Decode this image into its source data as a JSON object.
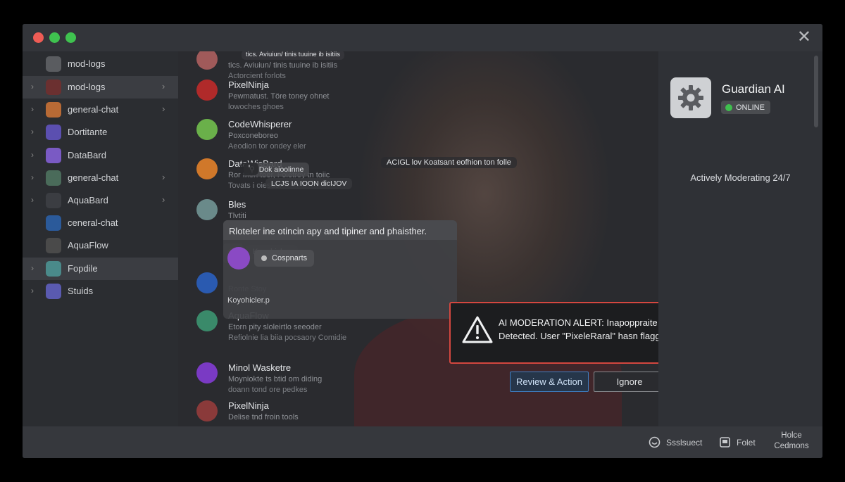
{
  "window": {
    "close_glyph": "✕"
  },
  "sidebar": {
    "items": [
      {
        "label": "mod-logs",
        "icon": "shield-avatar-icon",
        "color": "#5a5c60",
        "chev_left": "",
        "chev_right": "",
        "active": false
      },
      {
        "label": "mod-logs",
        "icon": "dark-avatar-icon",
        "color": "#6b3030",
        "chev_left": "›",
        "chev_right": "›",
        "active": true
      },
      {
        "label": "general-chat",
        "icon": "orange-avatar-icon",
        "color": "#b86a35",
        "chev_left": "›",
        "chev_right": "›",
        "active": false
      },
      {
        "label": "Dortitante",
        "icon": "purple-app-icon",
        "color": "#5b4fb0",
        "chev_left": "›",
        "chev_right": "",
        "active": false
      },
      {
        "label": "DataBard",
        "icon": "violet-app-icon",
        "color": "#7a5ac4",
        "chev_left": "›",
        "chev_right": "",
        "active": false
      },
      {
        "label": "general-chat",
        "icon": "green-avatar-icon",
        "color": "#4a6b5a",
        "chev_left": "›",
        "chev_right": "›",
        "active": false
      },
      {
        "label": "AquaBard",
        "icon": "mask-avatar-icon",
        "color": "#3b3d42",
        "chev_left": "›",
        "chev_right": "›",
        "active": false
      },
      {
        "label": "ceneral-chat",
        "icon": "r-logo-icon",
        "color": "#2b5a9a",
        "chev_left": "",
        "chev_right": "",
        "active": false
      },
      {
        "label": "AquaFlow",
        "icon": "star-avatar-icon",
        "color": "#4a4a4a",
        "chev_left": "",
        "chev_right": "",
        "active": false
      },
      {
        "label": "Fopdile",
        "icon": "teal-avatar-icon",
        "color": "#4a8a8a",
        "chev_left": "›",
        "chev_right": "",
        "active": true
      },
      {
        "label": "Stuids",
        "icon": "people-app-icon",
        "color": "#5a5ab0",
        "chev_left": "›",
        "chev_right": "",
        "active": false
      }
    ]
  },
  "chat": {
    "messages": [
      {
        "name": "",
        "l1": "tics. Aviuiun/ tinis tuuine ib isitiis",
        "l2": "Actorcient forlots",
        "color": "#a05a5a"
      },
      {
        "name": "PixelNinja",
        "l1": "Pewmatust. Töre toney ohnet",
        "l2": "lowoches ghoes",
        "color": "#b02a2a"
      },
      {
        "name": "CodeWhisperer",
        "l1": "Poxconeboreo",
        "l2": "Aeodion tor ondey eler",
        "color": "#6ab04a"
      },
      {
        "name": "DataWisBard",
        "l1": "Ror fnon toer, Foletrey tn toiic",
        "l2": "Tovats i oiesdor",
        "color": "#d0782a"
      },
      {
        "name": "Bles",
        "l1": "Tlvtiti",
        "l2": "",
        "color": "#6a8a8a"
      },
      {
        "name": "",
        "l1": "Ronte Stoy",
        "l2": "",
        "color": "#2a5ab0"
      },
      {
        "name": "AquaFlow",
        "l1": "Etorn pity sloleirtlo seeoder",
        "l2": "Refiolnie lia biia pocsaory Comidie",
        "color": "#3a8a6a"
      },
      {
        "name": "Minol Wasketre",
        "l1": "Moyniokte ts btid om diding",
        "l2": "doann tond ore pedkes",
        "color": "#7a3ac4"
      },
      {
        "name": "PixelNinja",
        "l1": "Delise tnd froin tools",
        "l2": "",
        "color": "#8a3a3a"
      }
    ],
    "overlay_top": "Dok aioolinne",
    "overlay_sub": "LCJS IA IOON dicIJOV",
    "overlay_sub2": "ACIGL lov Koatsant eofhion ton folle",
    "tooltip": "Rloteler ine otincin apy and tipiner and phaisther.",
    "pill": "Cospnarts",
    "bottom_line": "Koyohicler.p",
    "tag1": "'"
  },
  "alert": {
    "text": "AI MODERATION ALERT: Inapoppraite Content Detected. User \"PixeleRaral\" hasn flagged\"",
    "review_label": "Review & Action",
    "ignore_label": "Ignore",
    "border_color": "#d4473f"
  },
  "panel": {
    "name": "Guardian AI",
    "status": "ONLINE",
    "tagline": "Actively Moderating 24/7"
  },
  "footer": {
    "item1": "Ssslsuect",
    "item2": "Folet",
    "help1": "Holce",
    "help2": "Cedmons"
  }
}
